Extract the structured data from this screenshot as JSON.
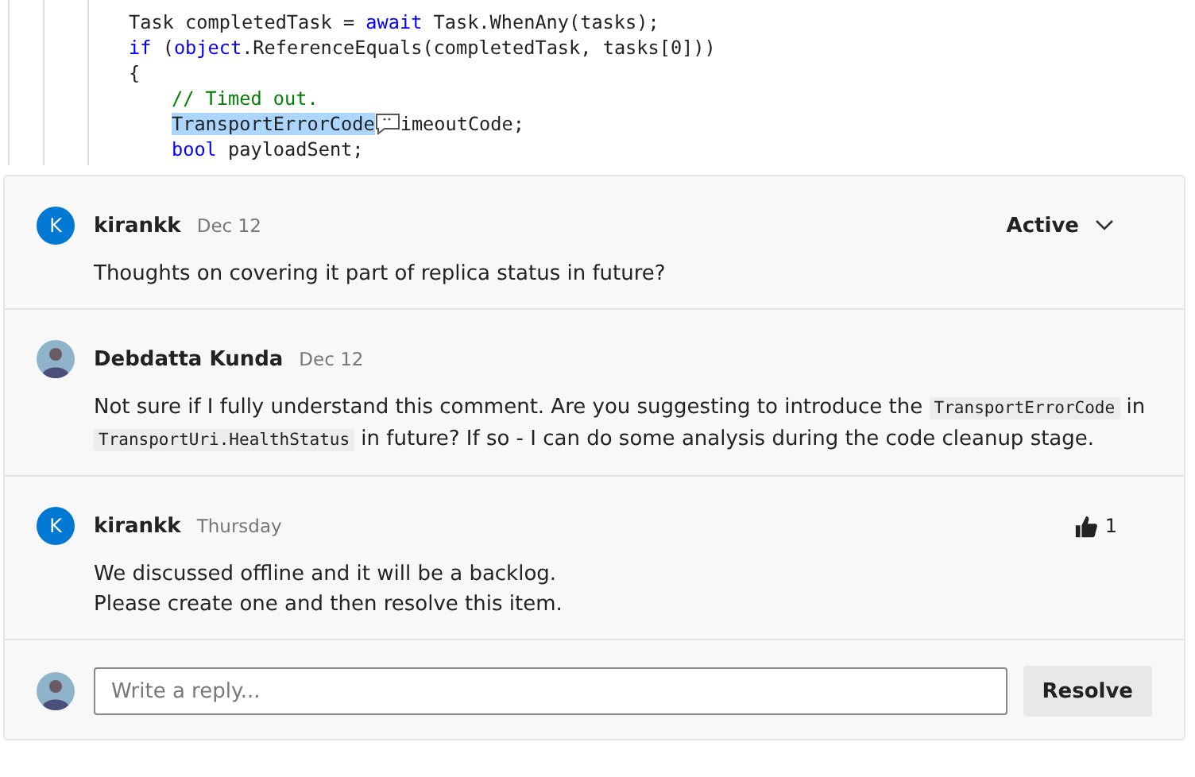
{
  "code": {
    "lines": [
      {
        "indented": false,
        "tokens": [
          {
            "text": "Task completedTask = ",
            "kind": "plain"
          },
          {
            "text": "await",
            "kind": "keyword"
          },
          {
            "text": " Task.WhenAny(tasks);",
            "kind": "plain"
          }
        ]
      },
      {
        "indented": false,
        "tokens": [
          {
            "text": "if",
            "kind": "keyword"
          },
          {
            "text": " (",
            "kind": "plain"
          },
          {
            "text": "object",
            "kind": "keyword"
          },
          {
            "text": ".ReferenceEquals(completedTask, tasks[0]))",
            "kind": "plain"
          }
        ]
      },
      {
        "indented": false,
        "tokens": [
          {
            "text": "{",
            "kind": "plain"
          }
        ]
      },
      {
        "indented": true,
        "tokens": [
          {
            "text": "// Timed out.",
            "kind": "comment"
          }
        ]
      },
      {
        "indented": true,
        "tokens": [
          {
            "text": "TransportErrorCode",
            "kind": "selected"
          },
          {
            "kind": "comment-marker"
          },
          {
            "text": "imeoutCode;",
            "kind": "plain"
          }
        ]
      },
      {
        "indented": true,
        "tokens": [
          {
            "text": "bool",
            "kind": "keyword"
          },
          {
            "text": " payloadSent;",
            "kind": "plain"
          }
        ]
      }
    ]
  },
  "thread": {
    "status": "Active",
    "comments": [
      {
        "author": "kirankk",
        "initial": "K",
        "kind": "initial",
        "date": "Dec 12",
        "body": [
          [
            {
              "text": "Thoughts on covering it part of replica status in future?",
              "kind": "text"
            }
          ]
        ]
      },
      {
        "author": "Debdatta Kunda",
        "kind": "photo",
        "date": "Dec 12",
        "body": [
          [
            {
              "text": "Not sure if I fully understand this comment. Are you suggesting to introduce the ",
              "kind": "text"
            },
            {
              "text": "TransportErrorCode",
              "kind": "code"
            },
            {
              "text": " in ",
              "kind": "text"
            },
            {
              "text": "TransportUri.HealthStatus",
              "kind": "code"
            },
            {
              "text": " in future? If so - I can do some analysis during the code cleanup stage.",
              "kind": "text"
            }
          ]
        ]
      },
      {
        "author": "kirankk",
        "initial": "K",
        "kind": "initial",
        "date": "Thursday",
        "likes": "1",
        "body": [
          [
            {
              "text": "We discussed offline and it will be a backlog.",
              "kind": "text"
            }
          ],
          [
            {
              "text": "Please create one and then resolve this item.",
              "kind": "text"
            }
          ]
        ]
      }
    ],
    "reply": {
      "placeholder": "Write a reply...",
      "button": "Resolve"
    }
  }
}
